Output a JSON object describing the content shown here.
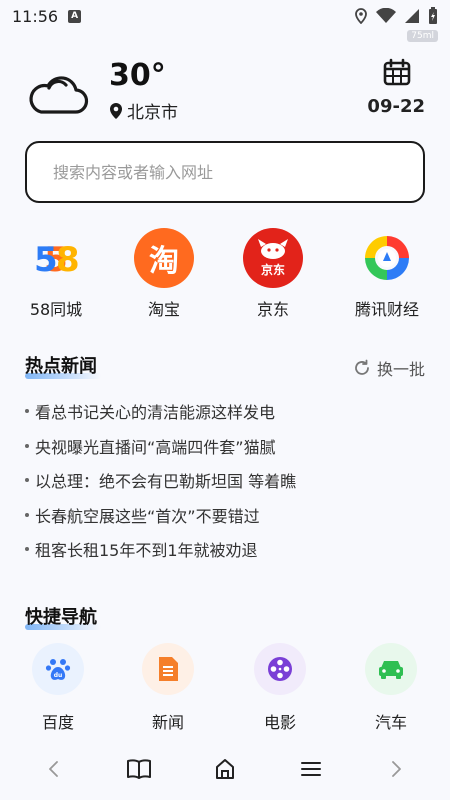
{
  "status_bar": {
    "time": "11:56",
    "badge": "A",
    "speed": "75ml"
  },
  "weather": {
    "temperature": "30°",
    "city": "北京市",
    "date": "09-22"
  },
  "search": {
    "placeholder": "搜索内容或者输入网址",
    "value": ""
  },
  "sites": [
    {
      "label": "58同城",
      "icon": "58-logo-icon"
    },
    {
      "label": "淘宝",
      "icon": "taobao-logo-icon",
      "glyph": "淘"
    },
    {
      "label": "京东",
      "icon": "jd-logo-icon",
      "glyph": "京东"
    },
    {
      "label": "腾讯财经",
      "icon": "tencent-finance-logo-icon"
    }
  ],
  "hot_news": {
    "title": "热点新闻",
    "refresh_label": "换一批",
    "items": [
      "看总书记关心的清洁能源这样发电",
      "央视曝光直播间“高端四件套”猫腻",
      "以总理：绝不会有巴勒斯坦国 等着瞧",
      "长春航空展这些“首次”不要错过",
      "租客长租15年不到1年就被劝退"
    ]
  },
  "quick_nav": {
    "title": "快捷导航",
    "items": [
      {
        "label": "百度",
        "icon": "baidu-paw-icon",
        "color": "#3478f6"
      },
      {
        "label": "新闻",
        "icon": "news-doc-icon",
        "color": "#f57f2a"
      },
      {
        "label": "电影",
        "icon": "film-reel-icon",
        "color": "#7a3fd6"
      },
      {
        "label": "汽车",
        "icon": "car-icon",
        "color": "#2fbf52"
      }
    ]
  },
  "colors": {
    "accent_blue": "#7fb5f5",
    "taobao": "#ff6a1f",
    "jd": "#e2231a"
  }
}
